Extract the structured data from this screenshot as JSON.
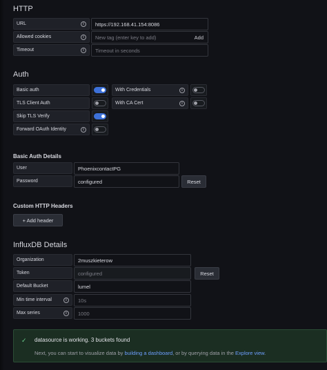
{
  "http": {
    "title": "HTTP",
    "url_label": "URL",
    "url_value": "https://192.168.41.154:8086",
    "cookies_label": "Allowed cookies",
    "cookies_placeholder": "New tag (enter key to add)",
    "cookies_add": "Add",
    "timeout_label": "Timeout",
    "timeout_placeholder": "Timeout in seconds"
  },
  "auth": {
    "title": "Auth",
    "basic_auth_label": "Basic auth",
    "basic_auth_on": true,
    "with_credentials_label": "With Credentials",
    "with_credentials_on": false,
    "tls_client_auth_label": "TLS Client Auth",
    "tls_client_auth_on": false,
    "with_ca_cert_label": "With CA Cert",
    "with_ca_cert_on": false,
    "skip_tls_label": "Skip TLS Verify",
    "skip_tls_on": true,
    "forward_oauth_label": "Forward OAuth Identity",
    "forward_oauth_on": false
  },
  "basic_auth_details": {
    "title": "Basic Auth Details",
    "user_label": "User",
    "user_value": "PhoenixcontactPG",
    "password_label": "Password",
    "password_value": "configured",
    "reset_label": "Reset"
  },
  "custom_headers": {
    "title": "Custom HTTP Headers",
    "add_header_label": "+ Add header"
  },
  "influx": {
    "title": "InfluxDB Details",
    "org_label": "Organization",
    "org_value": "2muszkieterow",
    "token_label": "Token",
    "token_value": "configured",
    "token_reset": "Reset",
    "bucket_label": "Default Bucket",
    "bucket_value": "lumel",
    "min_time_label": "Min time interval",
    "min_time_placeholder": "10s",
    "max_series_label": "Max series",
    "max_series_placeholder": "1000"
  },
  "alert": {
    "title": "datasource is working. 3 buckets found",
    "msg_prefix": "Next, you can start to visualize data by ",
    "link_dashboard": "building a dashboard",
    "msg_middle": ", or by querying data in the ",
    "link_explore": "Explore view",
    "msg_suffix": "."
  },
  "icons": {
    "info": "info-circle-icon",
    "check": "check-icon",
    "plus": "plus-icon"
  },
  "colors": {
    "accent": "#3d71d9",
    "success": "#6ccf8e",
    "link": "#6e9fff"
  }
}
